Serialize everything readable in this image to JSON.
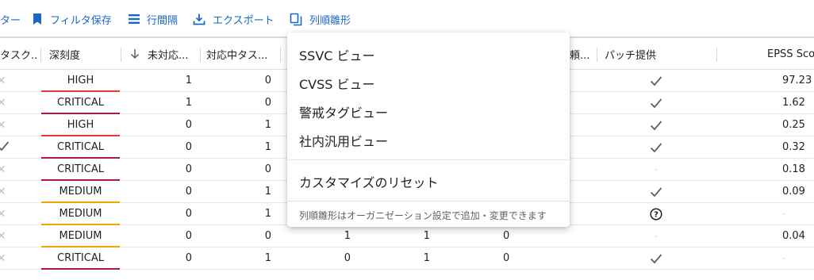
{
  "toolbar": {
    "filter_partial": "ター",
    "save_filter": "フィルタ保存",
    "row_spacing": "行間隔",
    "export": "エクスポート",
    "column_template": "列順雛形"
  },
  "columns": {
    "task": "タスク...",
    "severity": "深刻度",
    "unresolved": "未対応...",
    "in_progress": "対応中タス...",
    "request": "頼...",
    "patch": "パッチ提供",
    "epss": "EPSS Sco"
  },
  "rows": [
    {
      "task": "x",
      "severity": "HIGH",
      "sev_color": "#e53935",
      "unresolved": "1",
      "in_progress": "0",
      "c4": "",
      "c5": "",
      "c6": "",
      "patch": "check",
      "epss": "97.23"
    },
    {
      "task": "x",
      "severity": "CRITICAL",
      "sev_color": "#ad1457",
      "unresolved": "1",
      "in_progress": "0",
      "c4": "",
      "c5": "",
      "c6": "",
      "patch": "check",
      "epss": "1.62"
    },
    {
      "task": "x",
      "severity": "HIGH",
      "sev_color": "#e53935",
      "unresolved": "0",
      "in_progress": "1",
      "c4": "",
      "c5": "",
      "c6": "",
      "patch": "check",
      "epss": "0.25"
    },
    {
      "task": "check",
      "severity": "CRITICAL",
      "sev_color": "#ad1457",
      "unresolved": "0",
      "in_progress": "1",
      "c4": "",
      "c5": "",
      "c6": "",
      "patch": "check",
      "epss": "0.32"
    },
    {
      "task": "x",
      "severity": "CRITICAL",
      "sev_color": "#ad1457",
      "unresolved": "0",
      "in_progress": "0",
      "c4": "",
      "c5": "",
      "c6": "",
      "patch": "-",
      "epss": "0.18"
    },
    {
      "task": "x",
      "severity": "MEDIUM",
      "sev_color": "#f0a800",
      "unresolved": "0",
      "in_progress": "1",
      "c4": "",
      "c5": "",
      "c6": "",
      "patch": "check",
      "epss": "0.09"
    },
    {
      "task": "x",
      "severity": "MEDIUM",
      "sev_color": "#f0a800",
      "unresolved": "0",
      "in_progress": "1",
      "c4": "",
      "c5": "",
      "c6": "",
      "patch": "help",
      "epss": "-"
    },
    {
      "task": "x",
      "severity": "MEDIUM",
      "sev_color": "#f0a800",
      "unresolved": "0",
      "in_progress": "0",
      "c4": "1",
      "c5": "1",
      "c6": "0",
      "patch": "-",
      "epss": "0.04"
    },
    {
      "task": "x",
      "severity": "CRITICAL",
      "sev_color": "#ad1457",
      "unresolved": "0",
      "in_progress": "1",
      "c4": "0",
      "c5": "1",
      "c6": "0",
      "patch": "check",
      "epss": "-"
    }
  ],
  "menu": {
    "items": [
      "SSVC ビュー",
      "CVSS ビュー",
      "警戒タグビュー",
      "社内汎用ビュー"
    ],
    "reset": "カスタマイズのリセット",
    "note": "列順雛形はオーガニゼーション設定で追加・変更できます"
  },
  "colors": {
    "accent": "#1a67c4",
    "high": "#e53935",
    "critical": "#ad1457",
    "medium": "#f0a800"
  },
  "icons": {
    "save": "bookmark-icon",
    "spacing": "list-icon",
    "export": "download-icon",
    "template": "copy-icon",
    "sort": "arrow-down-icon",
    "patch_yes": "check-icon",
    "patch_unknown": "help-circle-icon"
  }
}
